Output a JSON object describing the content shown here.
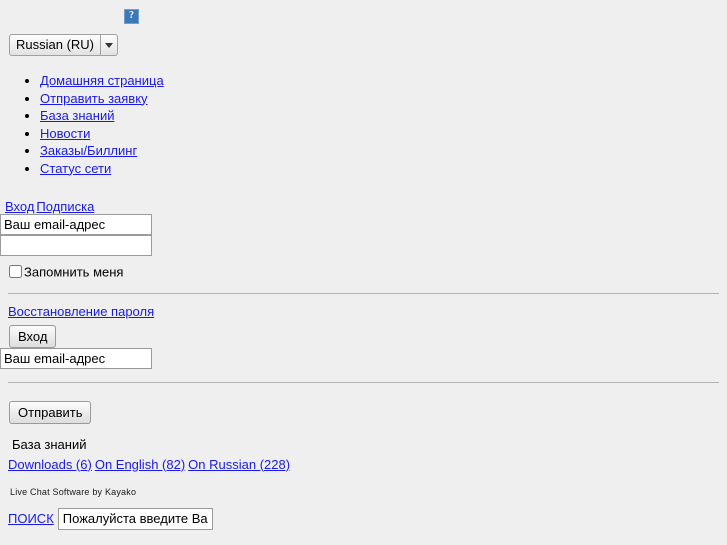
{
  "page": {
    "background_color": "#efefef",
    "link_color": "#1a1ae6",
    "text_color": "#000000"
  },
  "header": {
    "logo_icon": "broken-image-icon",
    "logo_alt": "?"
  },
  "language": {
    "selected": "Russian (RU)",
    "options": [
      "Russian (RU)"
    ],
    "arrow_icon": "chevron-down-icon"
  },
  "nav": {
    "items": [
      {
        "label": "Домашняя страница"
      },
      {
        "label": "Отправить заявку"
      },
      {
        "label": "База знаний"
      },
      {
        "label": "Новости"
      },
      {
        "label": "Заказы/Биллинг"
      },
      {
        "label": "Статус сети"
      }
    ]
  },
  "login": {
    "tab_login": "Вход",
    "tab_subscribe": "Подписка",
    "email_value": "Ваш email-адрес",
    "email_placeholder": "Ваш email-адрес",
    "password_value": "",
    "password_placeholder": "",
    "remember_label": "Запомнить меня",
    "remember_checked": false,
    "recover_link": "Восстановление пароля",
    "login_button": "Вход"
  },
  "subscribe": {
    "email_value": "Ваш email-адрес",
    "email_placeholder": "Ваш email-адрес",
    "submit_button": "Отправить"
  },
  "knowledgebase": {
    "title": "База знаний",
    "categories": [
      {
        "label": "Downloads (6)"
      },
      {
        "label": "On English (82)"
      },
      {
        "label": "On Russian (228)"
      }
    ]
  },
  "footer": {
    "credit": "Live Chat Software by Kayako"
  },
  "search": {
    "link_label": "ПОИСК",
    "input_value": "Пожалуйста введите Ва",
    "input_placeholder": "Пожалуйста введите Ваш запрос"
  }
}
